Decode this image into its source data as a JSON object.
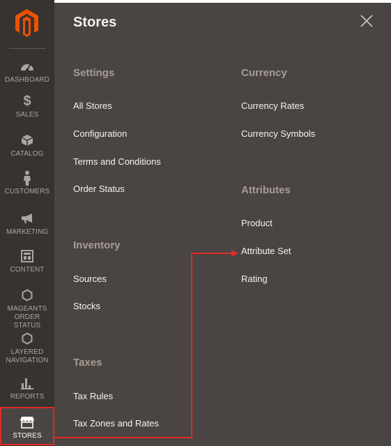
{
  "sidebar": {
    "logo": "magento-logo",
    "items": [
      {
        "label": "DASHBOARD",
        "icon": "dashboard-icon"
      },
      {
        "label": "SALES",
        "icon": "dollar-icon"
      },
      {
        "label": "CATALOG",
        "icon": "box-icon"
      },
      {
        "label": "CUSTOMERS",
        "icon": "person-icon"
      },
      {
        "label": "MARKETING",
        "icon": "megaphone-icon"
      },
      {
        "label": "CONTENT",
        "icon": "layout-icon"
      },
      {
        "label_line1": "MAGEANTS",
        "label_line2": "ORDER STATUS",
        "icon": "hexagon-icon"
      },
      {
        "label_line1": "LAYERED",
        "label_line2": "NAVIGATION",
        "icon": "hexagon-icon"
      },
      {
        "label": "REPORTS",
        "icon": "bar-chart-icon"
      },
      {
        "label": "STORES",
        "icon": "store-icon"
      }
    ]
  },
  "panel": {
    "title": "Stores",
    "settings": {
      "title": "Settings",
      "links": [
        "All Stores",
        "Configuration",
        "Terms and Conditions",
        "Order Status"
      ]
    },
    "inventory": {
      "title": "Inventory",
      "links": [
        "Sources",
        "Stocks"
      ]
    },
    "taxes": {
      "title": "Taxes",
      "links": [
        "Tax Rules",
        "Tax Zones and Rates"
      ]
    },
    "currency": {
      "title": "Currency",
      "links": [
        "Currency Rates",
        "Currency Symbols"
      ]
    },
    "attributes": {
      "title": "Attributes",
      "links": [
        "Product",
        "Attribute Set",
        "Rating"
      ]
    }
  },
  "colors": {
    "sidebar_bg": "#373330",
    "panel_bg": "#4a4542",
    "logo_orange": "#eb5202",
    "annotation_red": "#e02b27",
    "group_title": "#a79d95"
  }
}
